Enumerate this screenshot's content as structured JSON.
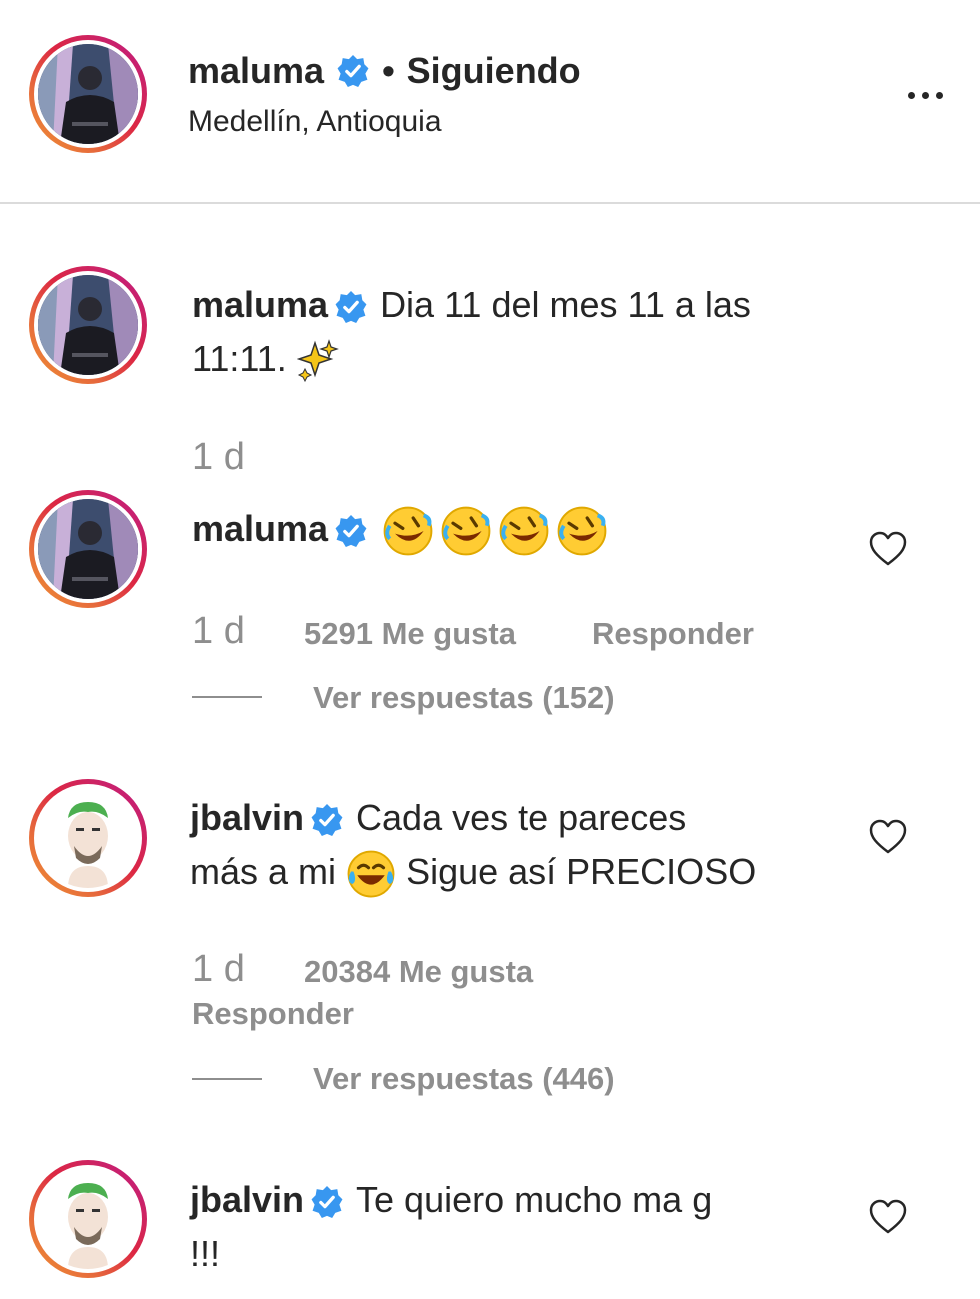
{
  "header": {
    "username": "maluma",
    "separator": "•",
    "following_label": "Siguiendo",
    "location": "Medellín, Antioquia"
  },
  "caption": {
    "username": "maluma",
    "text_line1": "Dia 11 del mes 11 a las",
    "text_line2": "11:11.",
    "emoji": "sparkles-icon",
    "time": "1 d"
  },
  "comments": [
    {
      "username": "maluma",
      "emoji": "rolling-on-floor-laughing-icon",
      "emoji_count": 4,
      "time": "1 d",
      "likes": "5291 Me gusta",
      "reply_label": "Responder",
      "view_replies": "Ver respuestas (152)"
    },
    {
      "username": "jbalvin",
      "text_line1": "Cada ves te pareces",
      "text_line2a": "más a mi",
      "emoji": "tears-of-joy-icon",
      "text_line2b": "Sigue así PRECIOSO",
      "time": "1 d",
      "likes": "20384 Me gusta",
      "reply_label": "Responder",
      "view_replies": "Ver respuestas (446)"
    },
    {
      "username": "jbalvin",
      "text_line1": "Te quiero mucho ma g",
      "text_line2": "!!!"
    }
  ],
  "colors": {
    "text": "#262626",
    "muted": "#8e8e8e",
    "verified": "#3897f0",
    "divider": "#dbdbdb",
    "story_ring_start": "#f09433",
    "story_ring_end": "#bc1888"
  }
}
